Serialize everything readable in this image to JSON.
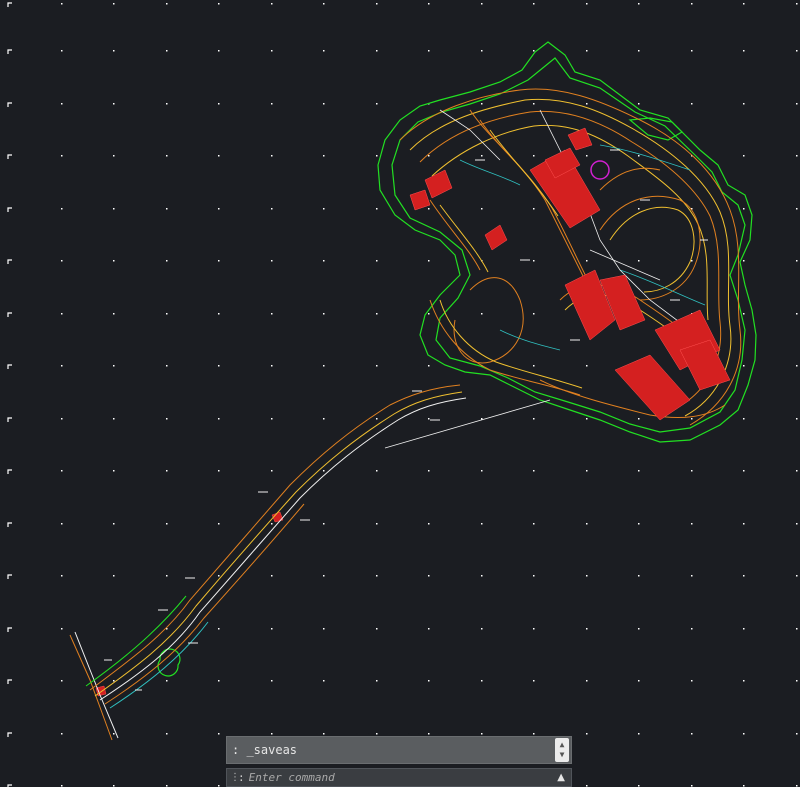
{
  "colors": {
    "background": "#1b1d22",
    "grid": "#ffffff",
    "contour_orange": "#e08020",
    "contour_yellow": "#f0c030",
    "boundary_green": "#22e022",
    "building_red": "#d42020",
    "line_white": "#f0f0f0",
    "line_cyan": "#30c0c0",
    "marker_magenta": "#d020d0"
  },
  "command_history": {
    "text": ": _saveas",
    "scroll_up_icon": "chevron-up-icon",
    "scroll_down_icon": "chevron-down-icon"
  },
  "command_line": {
    "prompt": ":",
    "placeholder": "Enter command",
    "value": "",
    "expand_icon": "triangle-up-icon"
  }
}
